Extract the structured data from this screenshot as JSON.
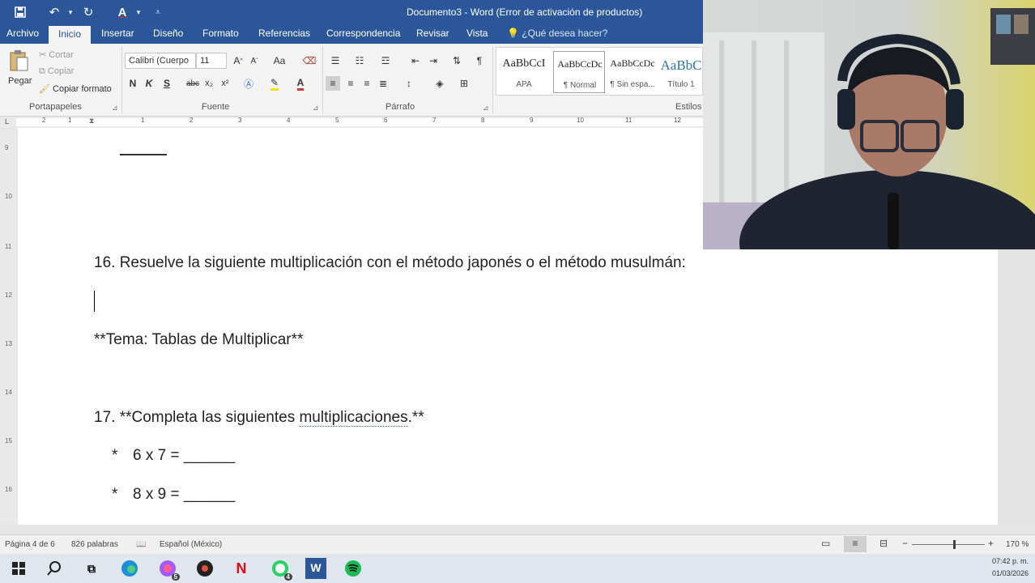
{
  "window": {
    "title": "Documento3 - Word (Error de activación de productos)"
  },
  "tabs": [
    {
      "label": "Archivo"
    },
    {
      "label": "Inicio"
    },
    {
      "label": "Insertar"
    },
    {
      "label": "Diseño"
    },
    {
      "label": "Formato"
    },
    {
      "label": "Referencias"
    },
    {
      "label": "Correspondencia"
    },
    {
      "label": "Revisar"
    },
    {
      "label": "Vista"
    }
  ],
  "tell_me": {
    "placeholder": "¿Qué desea hacer?",
    "icon": "lightbulb-icon"
  },
  "ribbon": {
    "clipboard": {
      "paste_label": "Pegar",
      "cut_label": "Cortar",
      "copy_label": "Copiar",
      "format_painter_label": "Copiar formato",
      "group_label": "Portapapeles"
    },
    "font": {
      "font_name": "Calibri (Cuerpo",
      "font_size": "11",
      "change_case_label": "Aa",
      "bold": "N",
      "italic": "K",
      "underline": "S",
      "strike": "abc",
      "subscript": "x₂",
      "superscript": "x²",
      "font_color": "A",
      "group_label": "Fuente"
    },
    "paragraph": {
      "group_label": "Párrafo"
    },
    "styles": {
      "items": [
        {
          "sample": "AaBbCcI",
          "name": "APA"
        },
        {
          "sample": "AaBbCcDc",
          "name": "¶ Normal"
        },
        {
          "sample": "AaBbCcDc",
          "name": "¶ Sin espa..."
        },
        {
          "sample": "AaBbC",
          "name": "Título 1"
        }
      ],
      "group_label": "Estilos"
    }
  },
  "ruler": {
    "numbers": [
      "2",
      "1",
      "1",
      "2",
      "3",
      "4",
      "5",
      "6",
      "7",
      "8",
      "9",
      "10",
      "11",
      "12"
    ],
    "vertical_numbers": [
      "9",
      "10",
      "11",
      "12",
      "13",
      "14",
      "15",
      "16"
    ]
  },
  "document": {
    "q16": "16. Resuelve la siguiente multiplicación con el método japonés o el método musulmán:",
    "topic": "**Tema: Tablas de Multiplicar**",
    "q17_prefix": "17. **Completa las siguientes ",
    "q17_misspelled": "multiplicaciones",
    "q17_suffix": ".**",
    "items": [
      {
        "bullet": "*",
        "text": "6 x 7 = ______"
      },
      {
        "bullet": "*",
        "text": "8 x 9 = ______"
      }
    ]
  },
  "statusbar": {
    "page": "Página 4 de 6",
    "words": "826 palabras",
    "language": "Español (México)",
    "zoom": "170 %",
    "zoom_minus": "−",
    "zoom_plus": "+"
  },
  "taskbar": {
    "icons": [
      "windows-start-icon",
      "search-icon",
      "task-view-icon",
      "edge-icon",
      "messenger-icon",
      "chrome-icon",
      "netflix-icon",
      "whatsapp-icon",
      "word-icon",
      "spotify-icon"
    ],
    "messenger_badge": "5",
    "whatsapp_badge": "4",
    "time": "07:42 p. m.",
    "date": "01/03/2026"
  },
  "colors": {
    "word_blue": "#2b579a",
    "ribbon_bg": "#f3f3f3",
    "taskbar_bg": "#dfe6ee"
  }
}
